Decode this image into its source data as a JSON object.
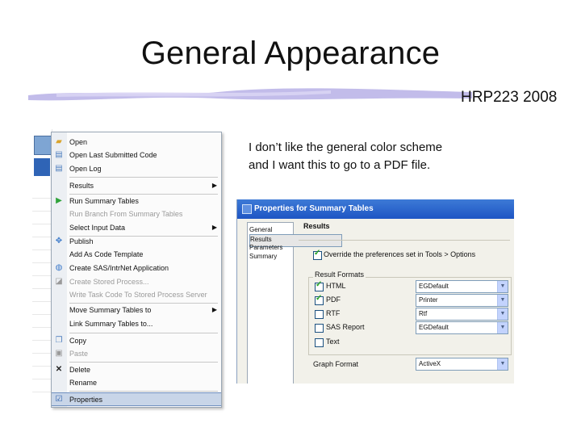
{
  "slide": {
    "title": "General Appearance",
    "subtitle": "HRP223 2008",
    "note_line1": "I don’t like the general color scheme",
    "note_line2": "and I want this to go to a PDF file.",
    "brush_color": "#b7b0e6"
  },
  "context_menu": {
    "items": [
      {
        "label": "Open",
        "icon": "folder-open-icon"
      },
      {
        "label": "Open Last Submitted Code",
        "icon": "document-icon"
      },
      {
        "label": "Open Log",
        "icon": "log-icon"
      },
      {
        "label": "Results",
        "submenu": true
      },
      {
        "label": "Run Summary Tables",
        "icon": "run-icon"
      },
      {
        "label": "Run Branch From Summary Tables",
        "disabled": true
      },
      {
        "label": "Select Input Data",
        "submenu": true
      },
      {
        "label": "Publish",
        "icon": "publish-icon"
      },
      {
        "label": "Add As Code Template"
      },
      {
        "label": "Create SAS/IntrNet Application",
        "icon": "globe-icon"
      },
      {
        "label": "Create Stored Process...",
        "disabled": true,
        "icon": "stored-process-icon"
      },
      {
        "label": "Write Task Code To Stored Process Server",
        "disabled": true
      },
      {
        "label": "Move Summary Tables to",
        "submenu": true
      },
      {
        "label": "Link Summary Tables to..."
      },
      {
        "label": "Copy",
        "icon": "copy-icon"
      },
      {
        "label": "Paste",
        "disabled": true,
        "icon": "paste-icon"
      },
      {
        "label": "Delete",
        "icon": "delete-icon"
      },
      {
        "label": "Rename"
      },
      {
        "label": "Properties",
        "selected": true,
        "icon": "properties-icon"
      }
    ]
  },
  "dialog": {
    "title": "Properties for Summary Tables",
    "nav_items": [
      "General",
      "Results",
      "Parameters",
      "Summary"
    ],
    "section_title": "Results",
    "override_label": "Override the preferences set in Tools > Options",
    "result_formats_label": "Result Formats",
    "formats": [
      {
        "label": "HTML",
        "checked": true,
        "value": "EGDefault"
      },
      {
        "label": "PDF",
        "checked": true,
        "value": "Printer"
      },
      {
        "label": "RTF",
        "checked": false,
        "value": "Rtf"
      },
      {
        "label": "SAS Report",
        "checked": false,
        "value": "EGDefault"
      },
      {
        "label": "Text",
        "checked": false,
        "value": ""
      }
    ],
    "graph_format_label": "Graph Format",
    "graph_format_value": "ActiveX"
  }
}
